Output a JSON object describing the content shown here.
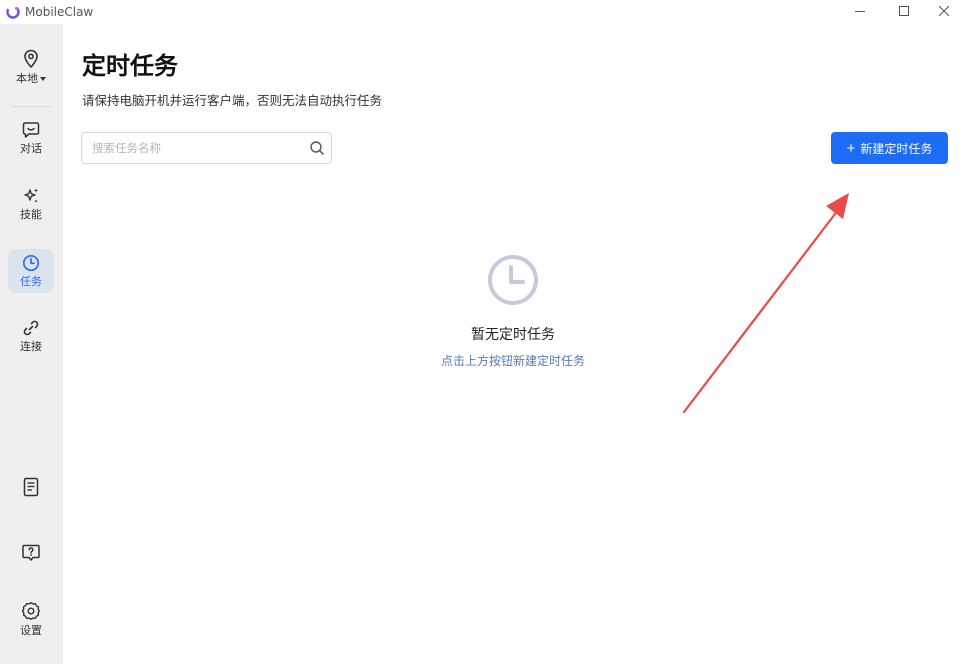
{
  "app": {
    "title": "MobileClaw",
    "accent_color": "#1e6bf5",
    "logo_color": "#7b4de0"
  },
  "window_controls": {
    "minimize_icon": "minimize-icon",
    "maximize_icon": "maximize-icon",
    "close_icon": "close-icon"
  },
  "sidebar": {
    "location": {
      "label": "本地",
      "icon": "location-pin-icon"
    },
    "items": [
      {
        "label": "对话",
        "icon": "chat-bubble-icon",
        "active": false
      },
      {
        "label": "技能",
        "icon": "sparkle-icon",
        "active": false
      },
      {
        "label": "任务",
        "icon": "clock-icon",
        "active": true
      },
      {
        "label": "连接",
        "icon": "link-icon",
        "active": false
      }
    ],
    "bottom": [
      {
        "label": "",
        "icon": "document-icon"
      },
      {
        "label": "",
        "icon": "help-icon"
      },
      {
        "label": "设置",
        "icon": "gear-icon"
      }
    ]
  },
  "main": {
    "title": "定时任务",
    "subtitle": "请保持电脑开机并运行客户端，否则无法自动执行任务",
    "search": {
      "placeholder": "搜索任务名称",
      "value": ""
    },
    "new_task_button": {
      "label": "新建定时任务",
      "icon": "plus-icon"
    },
    "empty_state": {
      "icon": "clock-icon",
      "title": "暂无定时任务",
      "hint": "点击上方按钮新建定时任务"
    }
  },
  "annotation": {
    "type": "red-arrow",
    "points_to": "new-task-button",
    "color": "#ec4a4a"
  }
}
